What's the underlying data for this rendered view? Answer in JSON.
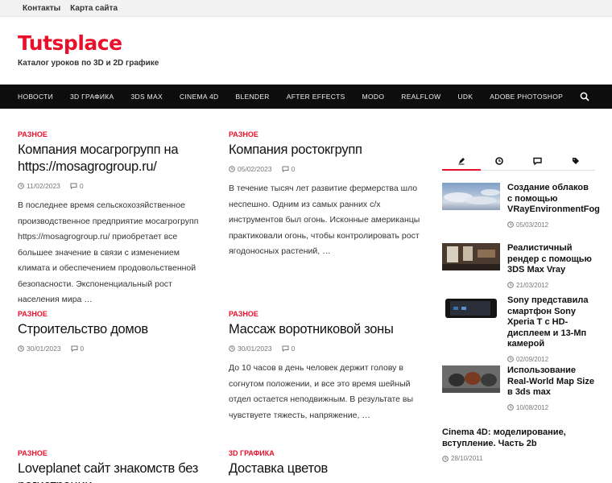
{
  "topbar": {
    "links": [
      "Контакты",
      "Карта сайта"
    ]
  },
  "header": {
    "title": "Tutsplace",
    "description": "Каталог уроков по 3D и 2D графике"
  },
  "nav": {
    "items": [
      "НОВОСТИ",
      "3D ГРАФИКА",
      "3DS MAX",
      "CINEMA 4D",
      "BLENDER",
      "AFTER EFFECTS",
      "MODO",
      "REALFLOW",
      "UDK",
      "ADOBE PHOTOSHOP"
    ]
  },
  "posts": [
    {
      "category": "Разное",
      "title": "Компания мосагрогрупп на https://mosagrogroup.ru/",
      "date": "11/02/2023",
      "comments": "0",
      "excerpt": "В последнее время сельскохозяйственное производственное предприятие мосагрогрупп https://mosagrogroup.ru/ приобретает все большее значение в связи с изменением климата и обеспечением продовольственной безопасности. Экспоненциальный рост населения мира …"
    },
    {
      "category": "Разное",
      "title": "Компания ростокгрупп",
      "date": "05/02/2023",
      "comments": "0",
      "excerpt": "В течение тысяч лет развитие фермерства шло неспешно. Одним из самых ранних с/х инструментов был огонь. Исконные американцы практиковали огонь, чтобы контролировать рост ягодоносных растений, …"
    },
    {
      "category": "Разное",
      "title": "Строительство домов",
      "date": "30/01/2023",
      "comments": "0",
      "excerpt": ""
    },
    {
      "category": "Разное",
      "title": "Массаж воротниковой зоны",
      "date": "30/01/2023",
      "comments": "0",
      "excerpt": "До 10 часов в день человек держит голову в согнутом положении, и все это время шейный отдел остается неподвижным. В результате вы чувствуете тяжесть, напряжение, …"
    },
    {
      "category": "Разное",
      "title": "Loveplanet сайт знакомств без регистрации",
      "date": "",
      "comments": "",
      "excerpt": ""
    },
    {
      "category": "3D Графика",
      "title": "Доставка цветов",
      "date": "",
      "comments": "",
      "excerpt": ""
    }
  ],
  "sidebar": {
    "tab_icons": [
      "pencil-icon",
      "clock-icon",
      "comment-icon",
      "tags-icon"
    ],
    "items": [
      {
        "title": "Создание облаков с помощью VRayEnvironmentFog",
        "date": "05/03/2012"
      },
      {
        "title": "Реалистичный рендер с помощью 3DS Max Vray",
        "date": "21/03/2012"
      },
      {
        "title": "Sony представила смартфон Sony Xperia T с HD-дисплеем и 13-Мп камерой",
        "date": "02/09/2012"
      },
      {
        "title": "Использование Real-World Map Size в 3ds max",
        "date": "10/08/2012"
      },
      {
        "title": "Cinema 4D: моделирование, вступление. Часть 2b",
        "date": "28/10/2011"
      }
    ]
  },
  "colors": {
    "accent": "#e8102a",
    "nav_bg": "#0d0d0d"
  }
}
